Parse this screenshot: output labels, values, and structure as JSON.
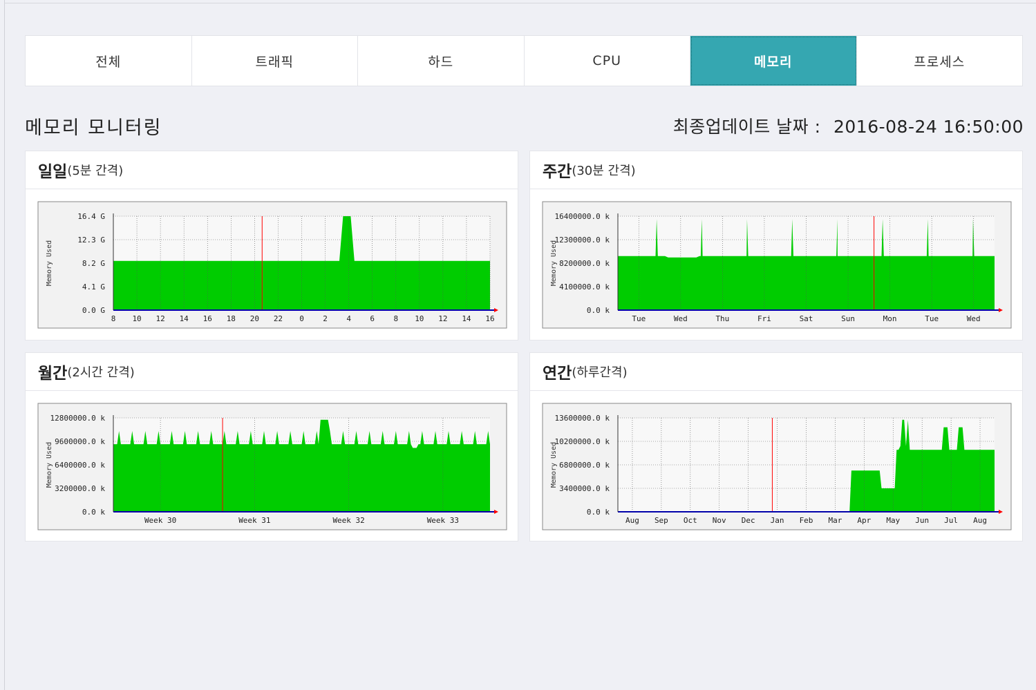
{
  "tabs": [
    "전체",
    "트래픽",
    "하드",
    "CPU",
    "메모리",
    "프로세스"
  ],
  "active_tab": 4,
  "page_title": "메모리 모니터링",
  "update_label": "최종업데이트 날짜 :",
  "update_value": "2016-08-24 16:50:00",
  "panels": [
    {
      "title": "일일",
      "sub": "(5분 간격)"
    },
    {
      "title": "주간",
      "sub": "(30분 간격)"
    },
    {
      "title": "월간",
      "sub": "(2시간 간격)"
    },
    {
      "title": "연간",
      "sub": "(하루간격)"
    }
  ],
  "chart_data": [
    {
      "type": "area",
      "ylabel": "Memory Used",
      "yticks": [
        "16.4 G",
        "12.3 G",
        "8.2 G",
        "4.1 G",
        "0.0 G"
      ],
      "ylim": [
        0,
        16.4
      ],
      "xticks": [
        "8",
        "10",
        "12",
        "14",
        "16",
        "18",
        "20",
        "22",
        "0",
        "2",
        "4",
        "6",
        "8",
        "10",
        "12",
        "14",
        "16"
      ],
      "baseline": 8.6,
      "series": [
        {
          "x": [
            0,
            0.6,
            0.61,
            0.62,
            0.625,
            0.63,
            0.64,
            1
          ],
          "values": [
            8.6,
            8.6,
            16.4,
            16.4,
            16.4,
            16.4,
            8.6,
            8.6
          ]
        }
      ],
      "marker_x": 0.395
    },
    {
      "type": "area",
      "ylabel": "Memory Used",
      "yticks": [
        "16400000.0 k",
        "12300000.0 k",
        "8200000.0 k",
        "4100000.0 k",
        "0.0 k"
      ],
      "ylim": [
        0,
        16400000
      ],
      "xticks": [
        "Tue",
        "Wed",
        "Thu",
        "Fri",
        "Sat",
        "Sun",
        "Mon",
        "Tue",
        "Wed"
      ],
      "marker_x": 0.68
    },
    {
      "type": "area",
      "ylabel": "Memory Used",
      "yticks": [
        "12800000.0 k",
        "9600000.0 k",
        "6400000.0 k",
        "3200000.0 k",
        "0.0 k"
      ],
      "ylim": [
        0,
        12800000
      ],
      "xticks": [
        "Week 30",
        "Week 31",
        "Week 32",
        "Week 33"
      ],
      "marker_x": 0.29
    },
    {
      "type": "area",
      "ylabel": "Memory Used",
      "yticks": [
        "13600000.0 k",
        "10200000.0 k",
        "6800000.0 k",
        "3400000.0 k",
        "0.0 k"
      ],
      "ylim": [
        0,
        13600000
      ],
      "xticks": [
        "Aug",
        "Sep",
        "Oct",
        "Nov",
        "Dec",
        "Jan",
        "Feb",
        "Mar",
        "Apr",
        "May",
        "Jun",
        "Jul",
        "Aug"
      ],
      "marker_x": 0.41
    }
  ],
  "colors": {
    "accent": "#35a7b1",
    "area": "#00cc00",
    "redline": "#ff0000"
  }
}
